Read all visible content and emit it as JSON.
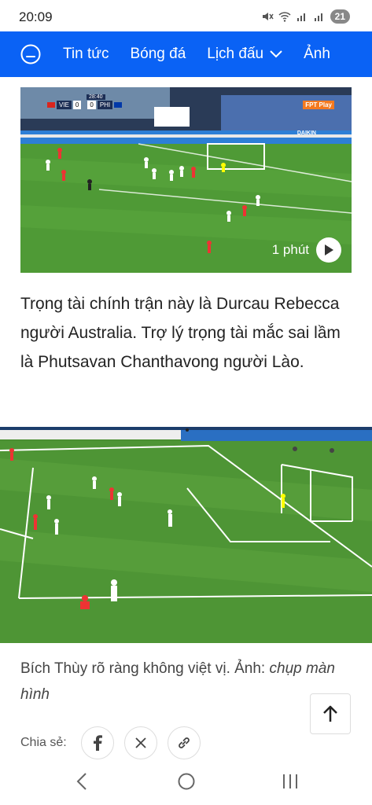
{
  "status_bar": {
    "time": "20:09",
    "battery": "21"
  },
  "navbar": {
    "items": [
      {
        "label": "Tin tức"
      },
      {
        "label": "Bóng đá"
      },
      {
        "label": "Lịch đấu"
      },
      {
        "label": "Ảnh"
      }
    ],
    "accent_color": "#0a62f5"
  },
  "video": {
    "duration": "1 phút",
    "scoreboard": {
      "time": "28:40",
      "home_team": "VIE",
      "home_score": "0",
      "away_score": "0",
      "away_team": "PHI"
    },
    "broadcaster": "FPT Play",
    "sponsor": "DAIKIN"
  },
  "article": {
    "paragraph": "Trọng tài chính trận này là Durcau Rebecca người Australia. Trợ lý trọng tài mắc sai lầm là Phutsavan Chanthavong người Lào."
  },
  "photo": {
    "caption_text": "Bích Thùy rõ ràng không việt vị. Ảnh: ",
    "caption_credit": "chụp màn hình"
  },
  "share": {
    "label": "Chia sẻ:",
    "buttons": [
      "facebook-icon",
      "x-icon",
      "link-icon"
    ]
  }
}
